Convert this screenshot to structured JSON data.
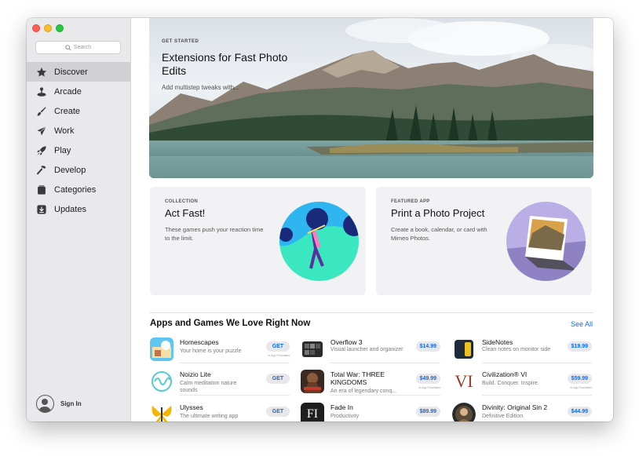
{
  "sidebar": {
    "search_placeholder": "Search",
    "nav": [
      {
        "label": "Discover",
        "icon": "star-icon",
        "active": true
      },
      {
        "label": "Arcade",
        "icon": "joystick-icon"
      },
      {
        "label": "Create",
        "icon": "brush-icon"
      },
      {
        "label": "Work",
        "icon": "paper-plane-icon"
      },
      {
        "label": "Play",
        "icon": "rocket-icon"
      },
      {
        "label": "Develop",
        "icon": "hammer-icon"
      },
      {
        "label": "Categories",
        "icon": "stack-icon"
      },
      {
        "label": "Updates",
        "icon": "download-icon"
      }
    ],
    "sign_in": "Sign In"
  },
  "hero": {
    "eyebrow": "GET STARTED",
    "title": "Extensions for Fast Photo Edits",
    "subtitle": "Add multistep tweaks with..."
  },
  "cards": [
    {
      "eyebrow": "COLLECTION",
      "title": "Act Fast!",
      "description": "These games push your reaction time to the limit."
    },
    {
      "eyebrow": "FEATURED APP",
      "title": "Print a Photo Project",
      "description": "Create a book, calendar, or card with Mimeo Photos."
    }
  ],
  "section": {
    "title": "Apps and Games We Love Right Now",
    "see_all": "See All"
  },
  "apps": [
    {
      "name": "Homescapes",
      "description": "Your home is your puzzle",
      "button": "GET",
      "iap": "In-App Purchases"
    },
    {
      "name": "Noizio Lite",
      "description": "Calm meditation nature sounds",
      "button": "GET",
      "iap": ""
    },
    {
      "name": "Ulysses",
      "description": "The ultimate writing app",
      "button": "GET",
      "iap": ""
    },
    {
      "name": "Overflow 3",
      "description": "Visual launcher and organizer",
      "button": "$14.99",
      "iap": ""
    },
    {
      "name": "Total War: THREE KINGDOMS",
      "description": "An era of legendary conq...",
      "button": "$49.99",
      "iap": "In-App Purchases"
    },
    {
      "name": "Fade In",
      "description": "Productivity",
      "button": "$89.99",
      "iap": ""
    },
    {
      "name": "SideNotes",
      "description": "Clean notes on monitor side",
      "button": "$19.99",
      "iap": ""
    },
    {
      "name": "Civilization® VI",
      "description": "Build. Conquer. Inspire.",
      "button": "$59.99",
      "iap": "In-App Purchases"
    },
    {
      "name": "Divinity: Original Sin 2",
      "description": "Definitive Edition",
      "button": "$44.99",
      "iap": ""
    }
  ],
  "icon_labels": {
    "fade_in": "FI",
    "civ": "VI"
  },
  "colors": {
    "accent": "#0a6cf0",
    "sidebar_bg": "#e9e9eb",
    "selected_row": "#d1d1d5"
  }
}
